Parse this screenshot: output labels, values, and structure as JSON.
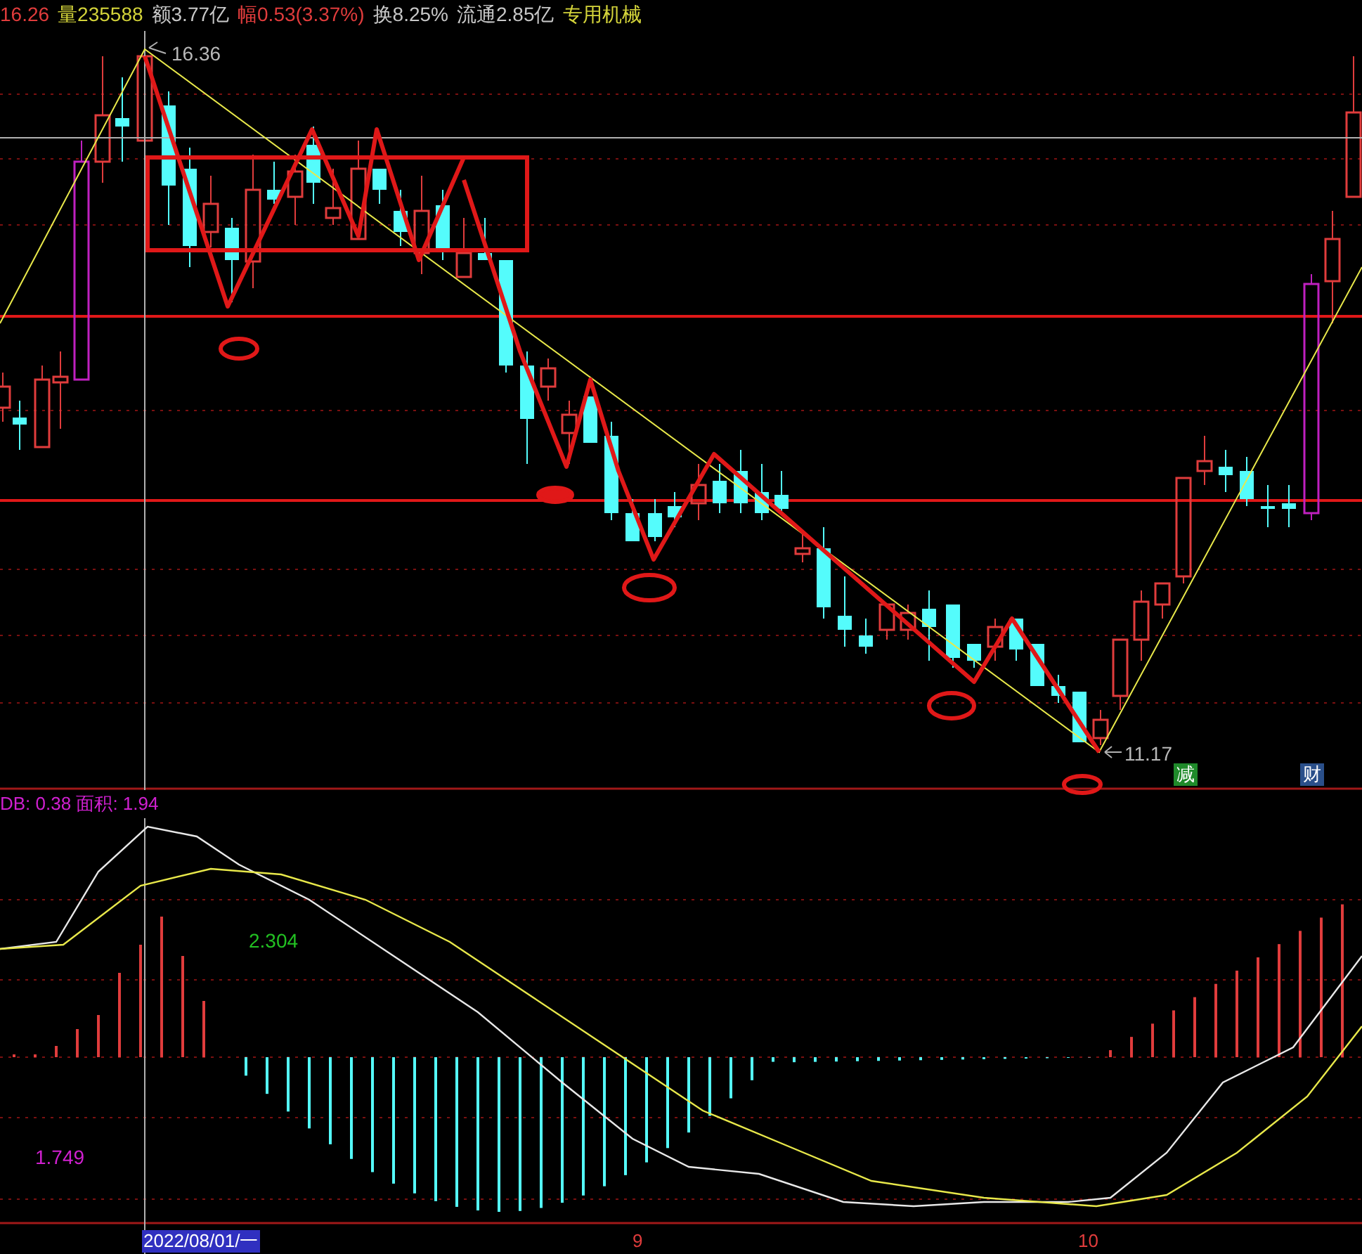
{
  "header": [
    {
      "text": "16.26",
      "color": "#e03c3c"
    },
    {
      "text": "量235588",
      "color": "#d4d43a"
    },
    {
      "text": "额3.77亿",
      "color": "#c8c8c8"
    },
    {
      "text": "幅0.53(3.37%)",
      "color": "#e03c3c"
    },
    {
      "text": "换8.25%",
      "color": "#c8c8c8"
    },
    {
      "text": "流通2.85亿",
      "color": "#c8c8c8"
    },
    {
      "text": "专用机械",
      "color": "#d4d43a"
    }
  ],
  "price_chart": {
    "high_label": "16.36",
    "low_label": "11.17",
    "markers": [
      {
        "text": "减",
        "color": "#1f8a2a"
      },
      {
        "text": "财",
        "color": "#2a4f8a"
      }
    ]
  },
  "indicator": {
    "header": "DB: 0.38 面积: 1.94",
    "value_labels": [
      {
        "text": "2.304",
        "color": "#22c022"
      },
      {
        "text": "1.749",
        "color": "#d020d0"
      }
    ]
  },
  "x_axis": {
    "date_label": "2022/08/01/一",
    "ticks": [
      "9",
      "10"
    ]
  }
}
